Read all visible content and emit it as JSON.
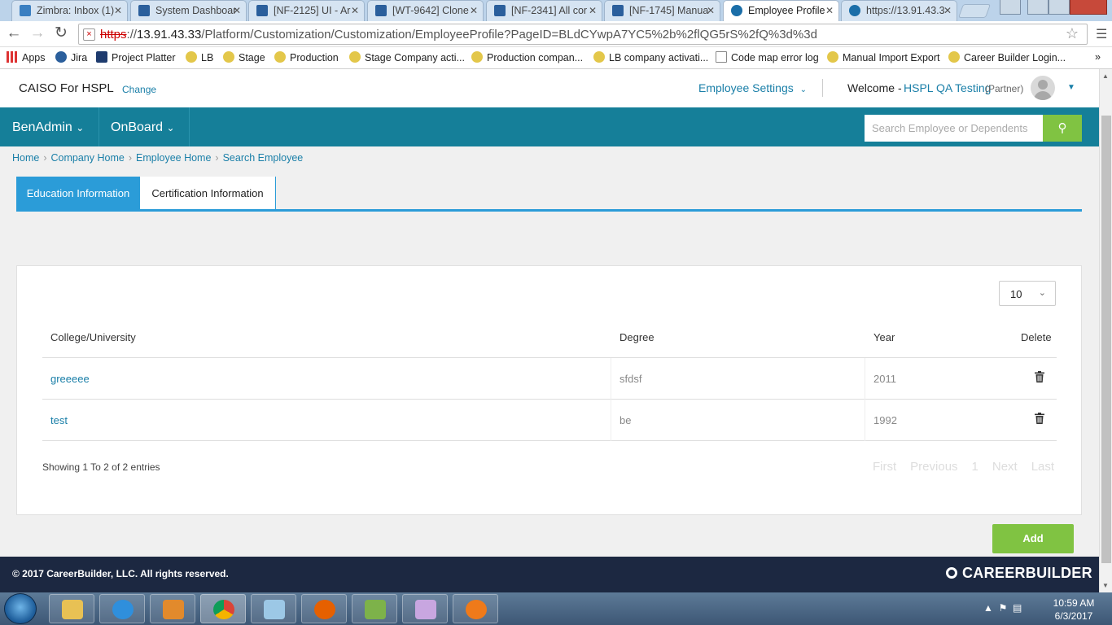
{
  "browser": {
    "tabs": [
      {
        "title": "Zimbra: Inbox (1)",
        "icon": "zimbra-icon"
      },
      {
        "title": "System Dashboar",
        "icon": "jira-icon"
      },
      {
        "title": "[NF-2125] UI - Ar",
        "icon": "jira-icon"
      },
      {
        "title": "[WT-9642] Clone",
        "icon": "jira-icon"
      },
      {
        "title": "[NF-2341] All cor",
        "icon": "jira-icon"
      },
      {
        "title": "[NF-1745] Manua",
        "icon": "jira-icon"
      },
      {
        "title": "Employee Profile",
        "icon": "page-icon"
      },
      {
        "title": "https://13.91.43.3",
        "icon": "page-icon"
      }
    ],
    "close_glyph": "✕",
    "url": {
      "scheme": "https",
      "rest": "://",
      "host": "13.91.43.33",
      "path": "/Platform/Customization/Customization/EmployeeProfile?PageID=BLdCYwpA7YC5%2b%2flQG5rS%2fQ%3d%3d"
    },
    "bookmarks": [
      {
        "label": "Apps",
        "icon": "apps-grid-icon"
      },
      {
        "label": "Jira",
        "icon": "jira-icon"
      },
      {
        "label": "Project Platter",
        "icon": "platter-icon"
      },
      {
        "label": "LB",
        "icon": "globe-icon"
      },
      {
        "label": "Stage",
        "icon": "globe-icon"
      },
      {
        "label": "Production",
        "icon": "globe-icon"
      },
      {
        "label": "Stage Company acti...",
        "icon": "globe-icon"
      },
      {
        "label": "Production compan...",
        "icon": "globe-icon"
      },
      {
        "label": "LB company activati...",
        "icon": "globe-icon"
      },
      {
        "label": "Code map error log",
        "icon": "page-icon"
      },
      {
        "label": "Manual Import Export",
        "icon": "globe-icon"
      },
      {
        "label": "Career Builder Login...",
        "icon": "globe-icon"
      }
    ],
    "overflow": "»"
  },
  "header": {
    "company": "CAISO For HSPL",
    "change_label": "Change",
    "employee_settings": "Employee Settings",
    "welcome": "Welcome -",
    "user_name": "HSPL QA Testing",
    "user_role": "(Partner)"
  },
  "nav": {
    "items": [
      {
        "label": "BenAdmin"
      },
      {
        "label": "OnBoard"
      }
    ],
    "search_placeholder": "Search Employee or Dependents"
  },
  "breadcrumb": [
    "Home",
    "Company Home",
    "Employee Home",
    "Search Employee"
  ],
  "tabs": [
    {
      "label": "Education Information",
      "active": true
    },
    {
      "label": "Certification Information",
      "active": false
    }
  ],
  "table": {
    "page_size": "10",
    "columns": [
      "College/University",
      "Degree",
      "Year",
      "Delete"
    ],
    "rows": [
      {
        "college": "greeeee",
        "degree": "sfdsf",
        "year": "2011"
      },
      {
        "college": "test",
        "degree": "be",
        "year": "1992"
      }
    ],
    "summary": "Showing 1 To 2 of 2 entries",
    "pager": [
      "First",
      "Previous",
      "1",
      "Next",
      "Last"
    ]
  },
  "add_label": "Add",
  "footer": {
    "copyright": "© 2017 CareerBuilder, LLC. All rights reserved.",
    "logo_text": "CAREERBUILDER"
  },
  "taskbar": {
    "time": "10:59 AM",
    "date": "6/3/2017"
  },
  "colors": {
    "nav_bg": "#157f99",
    "accent_blue": "#2b9cd8",
    "link": "#1a7fa8",
    "green": "#80c342",
    "footer_bg": "#1c2841"
  }
}
